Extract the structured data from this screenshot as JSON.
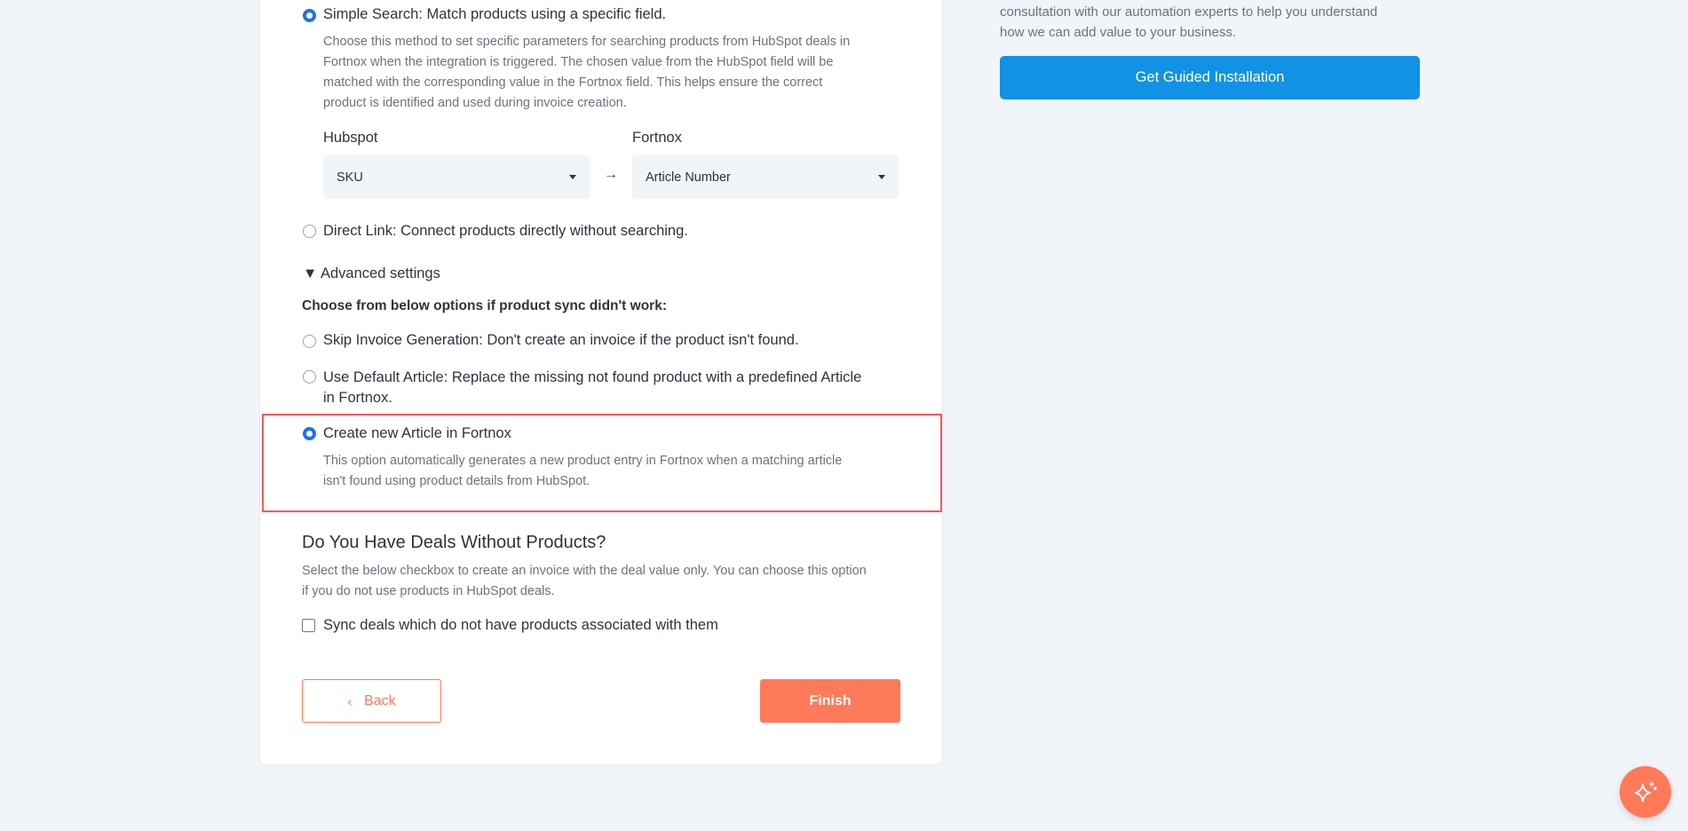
{
  "product_match": {
    "simple_search": {
      "label": "Simple Search: Match products using a specific field.",
      "selected": true,
      "description": [
        "Choose this method to set specific parameters for searching products from HubSpot deals in",
        "Fortnox when the integration is triggered. The chosen value from the HubSpot field will be",
        "matched with the corresponding value in the Fortnox field. This helps ensure the correct",
        "product is identified and used during invoice creation."
      ]
    },
    "hubspot_label": "Hubspot",
    "hubspot_value": "SKU",
    "arrow": "→",
    "fortnox_label": "Fortnox",
    "fortnox_value": "Article Number",
    "direct_link": {
      "label": "Direct Link: Connect products directly without searching.",
      "selected": false
    }
  },
  "advanced": {
    "toggle": "▼ Advanced settings",
    "heading": "Choose from below options if product sync didn't work:",
    "skip": {
      "label": "Skip Invoice Generation: Don't create an invoice if the product isn't found.",
      "selected": false
    },
    "default_article": {
      "line1": "Use Default Article: Replace the missing not found product with a predefined Article",
      "line2": "in Fortnox.",
      "selected": false
    },
    "create_new": {
      "label": "Create new Article in Fortnox",
      "selected": true,
      "description": [
        "This option automatically generates a new product entry in Fortnox when a matching article",
        "isn't found using product details from HubSpot."
      ]
    }
  },
  "deals": {
    "heading": "Do You Have Deals Without Products?",
    "description": [
      "Select the below checkbox to create an invoice with the deal value only. You can choose this option",
      "if you do not use products in HubSpot deals."
    ],
    "checkbox_label": "Sync deals which do not have products associated with them",
    "checked": false
  },
  "nav": {
    "back": "Back",
    "finish": "Finish"
  },
  "sidebar": {
    "text": [
      "consultation with our automation experts to help you understand",
      "how we can add value to your business."
    ],
    "button": "Get Guided Installation"
  },
  "colors": {
    "accent": "#1a73e8",
    "finish": "#ff7a59",
    "guided": "#1192e5",
    "highlight": "#ef5a5f"
  }
}
